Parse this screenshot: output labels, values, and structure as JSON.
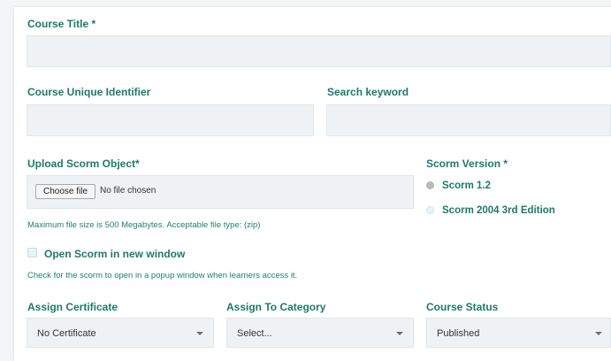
{
  "form": {
    "course_title": {
      "label": "Course Title *",
      "value": ""
    },
    "course_unique_identifier": {
      "label": "Course Unique Identifier",
      "value": ""
    },
    "search_keyword": {
      "label": "Search keyword",
      "value": ""
    },
    "upload": {
      "label": "Upload Scorm Object*",
      "choose_button": "Choose file",
      "no_file_text": "No file chosen",
      "help": "Maximum file size is 500 Megabytes. Acceptable file type: (zip)"
    },
    "scorm_version": {
      "label": "Scorm Version *",
      "options": [
        {
          "label": "Scorm 1.2",
          "checked": true
        },
        {
          "label": "Scorm 2004 3rd Edition",
          "checked": false
        }
      ]
    },
    "open_new_window": {
      "label": "Open Scorm in new window",
      "checked": false,
      "help": "Check for the scorm to open in a popup window when learners access it."
    },
    "assign_certificate": {
      "label": "Assign Certificate",
      "selected": "No Certificate"
    },
    "assign_category": {
      "label": "Assign To Category",
      "selected": "Select..."
    },
    "course_status": {
      "label": "Course Status",
      "selected": "Published"
    }
  },
  "colors": {
    "label": "#1d7a68",
    "field_bg": "#eff2f5",
    "card_bg": "#ffffff"
  }
}
